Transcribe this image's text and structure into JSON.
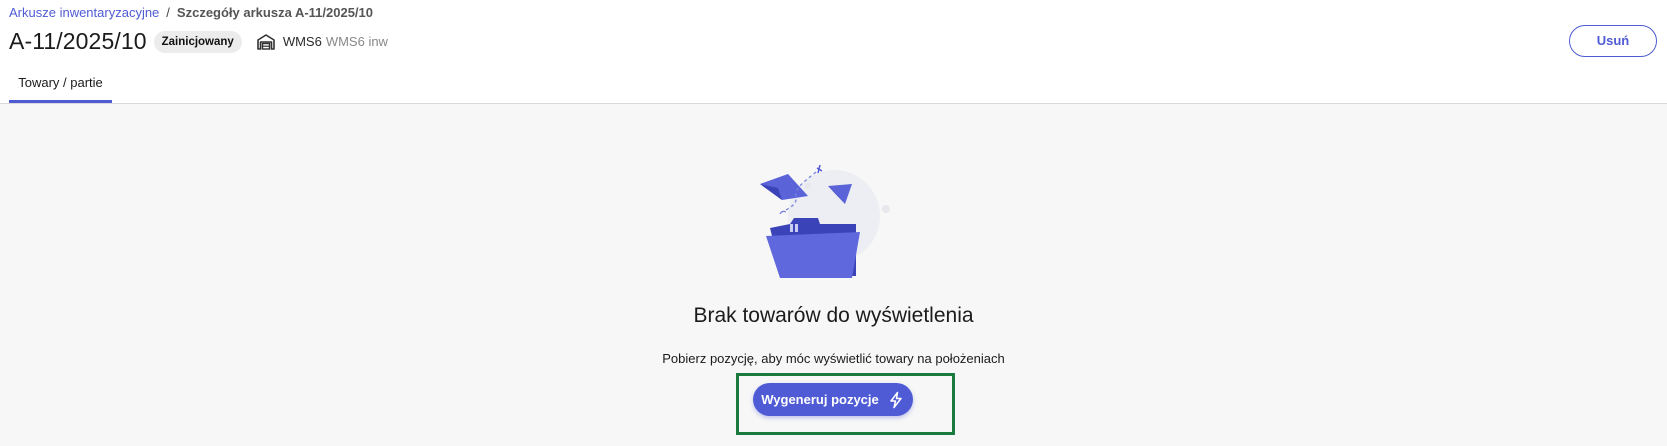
{
  "breadcrumb": {
    "parent": "Arkusze inwentaryzacyjne",
    "separator": "/",
    "current": "Szczegóły arkusza A-11/2025/10"
  },
  "header": {
    "title": "A-11/2025/10",
    "status": "Zainicjowany",
    "warehouse_icon": "warehouse-icon",
    "warehouse_code": "WMS6",
    "warehouse_name": "WMS6 inw",
    "delete_label": "Usuń"
  },
  "tabs": [
    {
      "label": "Towary / partie",
      "active": true
    }
  ],
  "empty_state": {
    "illustration": "empty-folder-illustration",
    "title": "Brak towarów do wyświetlenia",
    "subtitle": "Pobierz pozycję, aby móc wyświetlić towary na położeniach",
    "button_label": "Wygeneruj pozycje",
    "button_icon": "lightning-icon"
  },
  "colors": {
    "accent": "#4f5bd5",
    "highlight": "#1b7a3e",
    "background": "#f7f7f7"
  }
}
